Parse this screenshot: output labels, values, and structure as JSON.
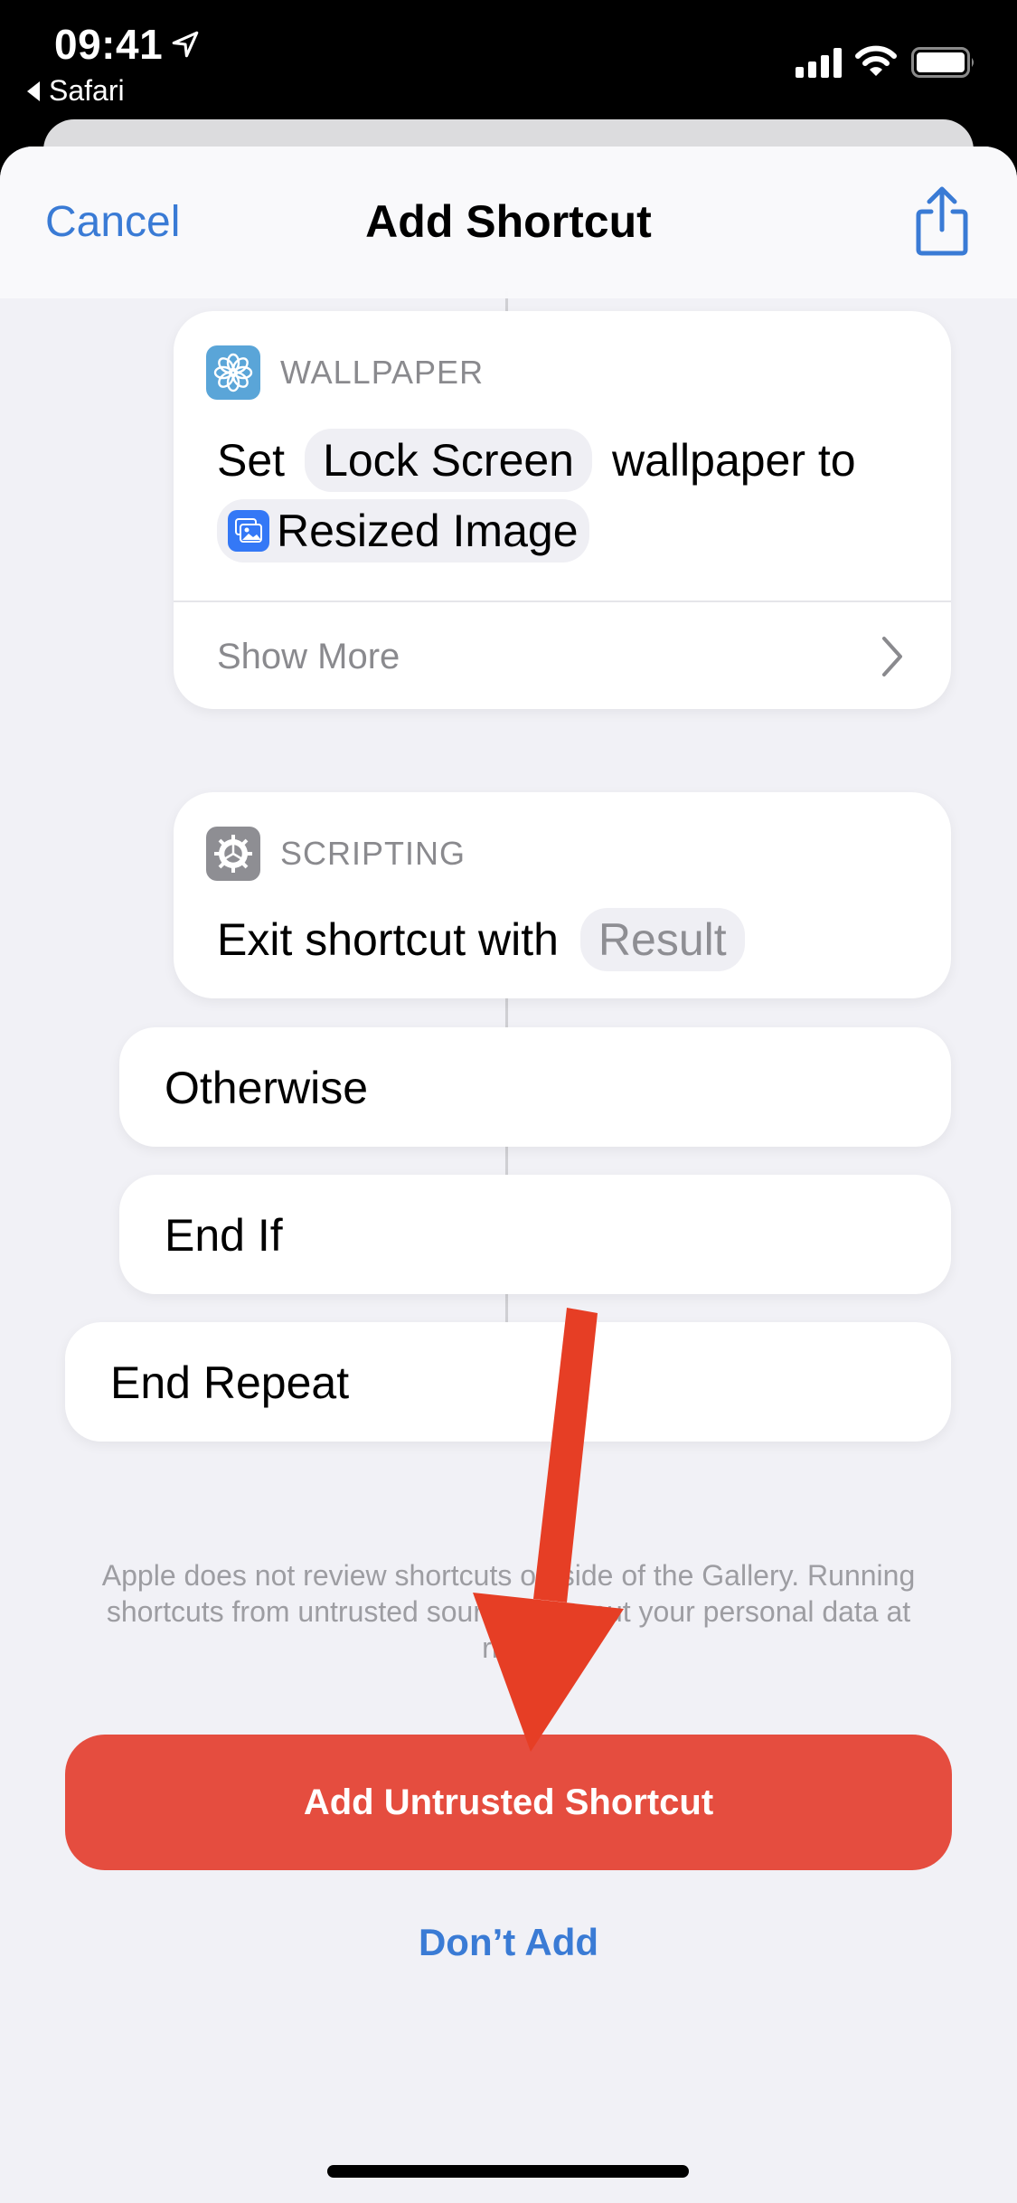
{
  "status_bar": {
    "time": "09:41",
    "back_app": "Safari",
    "icons": [
      "location-arrow-icon",
      "cellular-signal-icon",
      "wifi-icon",
      "battery-icon"
    ]
  },
  "nav": {
    "cancel_label": "Cancel",
    "title": "Add Shortcut",
    "share_icon": "share-icon"
  },
  "actions": [
    {
      "category": "WALLPAPER",
      "category_icon": "wallpaper-flower-icon",
      "category_color": "#5aa5d8",
      "text_before": "Set",
      "param_1": "Lock Screen",
      "text_middle": "wallpaper to",
      "variable": "Resized Image",
      "variable_icon": "photo-variable-icon",
      "show_more_label": "Show More"
    },
    {
      "category": "SCRIPTING",
      "category_icon": "gear-icon",
      "category_color": "#8e8e93",
      "text_before": "Exit shortcut with",
      "param_placeholder": "Result"
    }
  ],
  "control_blocks": [
    {
      "label": "Otherwise"
    },
    {
      "label": "End If"
    },
    {
      "label": "End Repeat"
    }
  ],
  "footer": {
    "disclaimer": "Apple does not review shortcuts outside of the Gallery. Running shortcuts from untrusted sources can put your personal data at risk.",
    "primary_button": "Add Untrusted Shortcut",
    "secondary_button": "Don’t Add"
  },
  "colors": {
    "accent_blue": "#3a7bd5",
    "danger_red": "#e54d3f",
    "annotation_arrow": "#e63e25",
    "sheet_background": "#f1f1f6"
  },
  "annotation": {
    "type": "arrow",
    "points_to": "Add Untrusted Shortcut"
  }
}
